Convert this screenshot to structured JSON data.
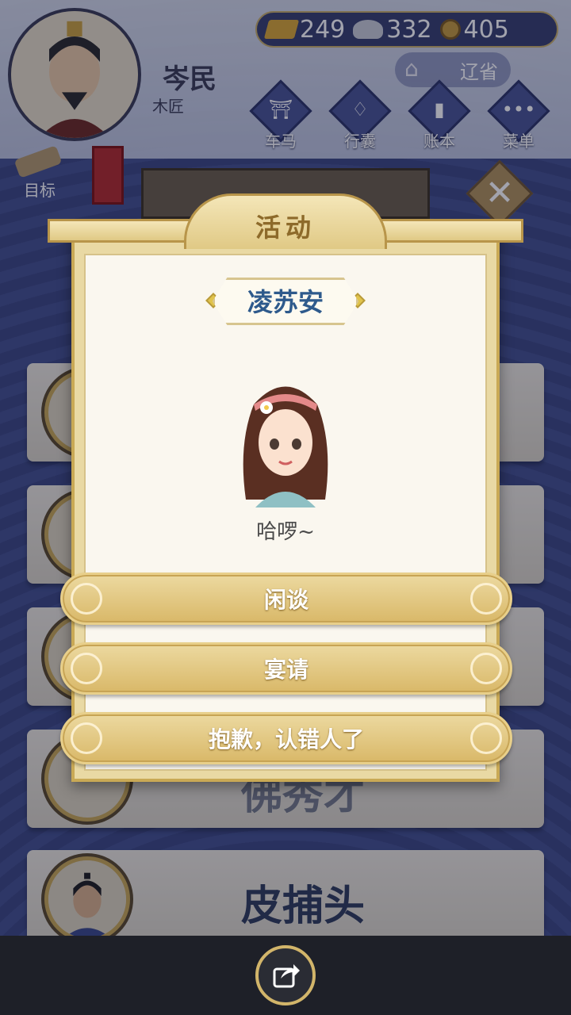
{
  "player": {
    "name": "岑民",
    "job": "木匠"
  },
  "resources": {
    "gold": "249",
    "silver": "332",
    "coin": "405"
  },
  "province_button": "辽省",
  "nav": [
    {
      "label": "车马",
      "icon": "carriage-icon"
    },
    {
      "label": "行囊",
      "icon": "bag-icon"
    },
    {
      "label": "账本",
      "icon": "ledger-icon"
    },
    {
      "label": "菜单",
      "icon": "menu-dots-icon"
    }
  ],
  "goal_button": "目标",
  "background_cards": {
    "last_name": "皮捕头",
    "partial_name": "佛秀才"
  },
  "dialog": {
    "title": "活动",
    "npc_name": "凌苏安",
    "greeting": "哈啰~",
    "choices": [
      "闲谈",
      "宴请",
      "抱歉，认错人了"
    ]
  },
  "colors": {
    "accent": "#d9b868",
    "npc_name": "#2e5a8c",
    "background": "#3d4a86"
  }
}
